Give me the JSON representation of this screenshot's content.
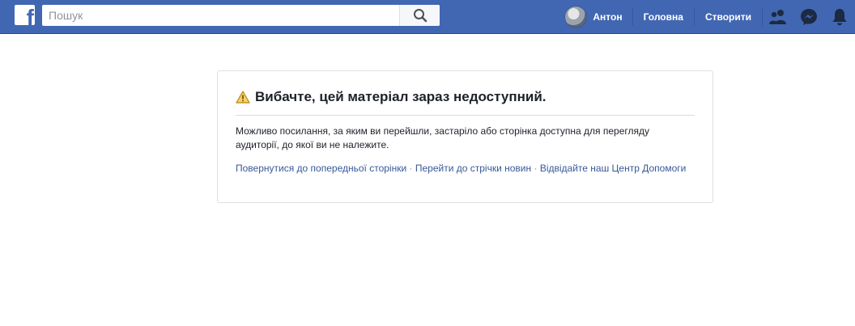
{
  "header": {
    "logo_letter": "f",
    "search": {
      "placeholder": "Пошук",
      "value": ""
    },
    "profile_name": "Антон",
    "nav": {
      "home": "Головна",
      "create": "Створити"
    },
    "icons": [
      "friends-icon",
      "messenger-icon",
      "notifications-icon"
    ],
    "brand_color": "#4267b2"
  },
  "error": {
    "title": "Вибачте, цей матеріал зараз недоступний.",
    "message": "Можливо посилання, за яким ви перейшли, застаріло або сторінка доступна для перегляду аудиторії, до якої ви не належите.",
    "links": {
      "back": "Повернутися до попередньої сторінки",
      "separator": "·",
      "news_feed": "Перейти до стрічки новин",
      "help": "Відвідайте наш Центр Допомоги"
    }
  }
}
